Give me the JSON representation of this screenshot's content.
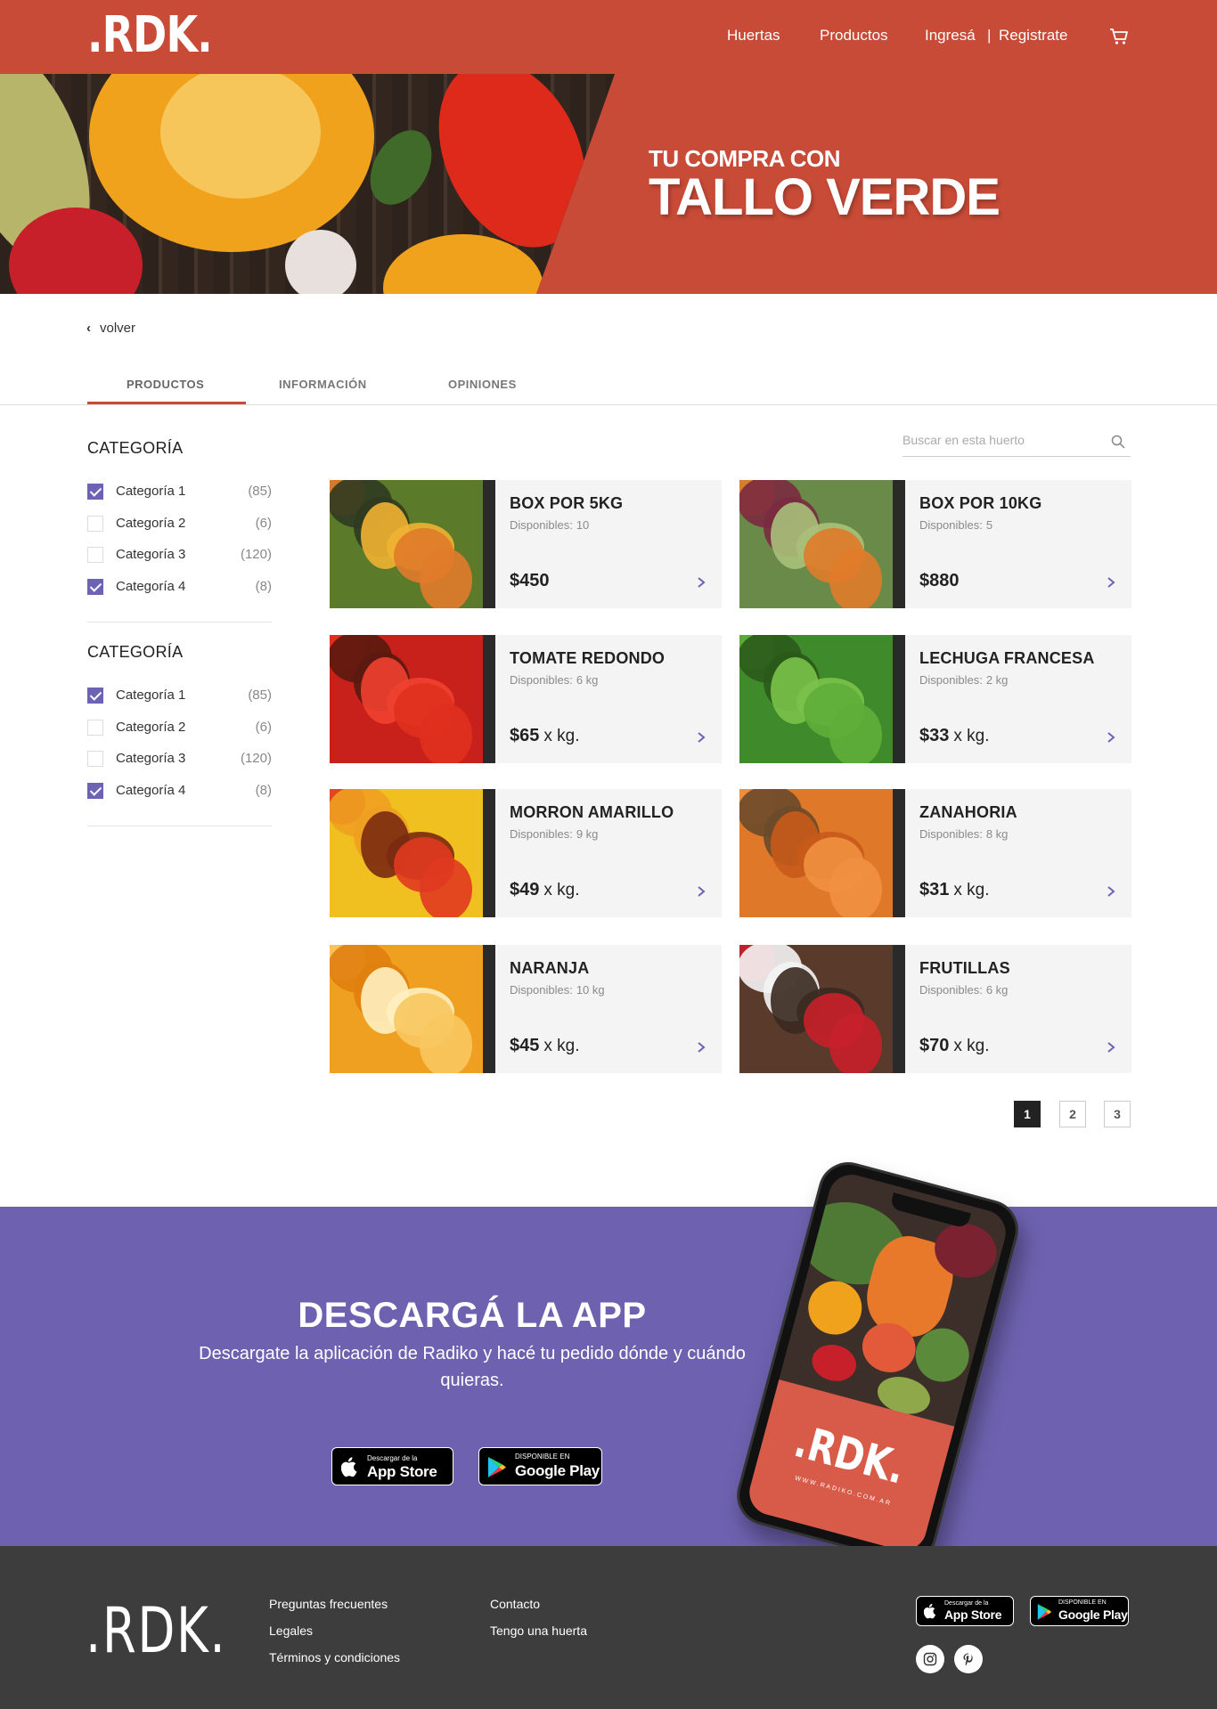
{
  "header": {
    "logo": ".RDK.",
    "nav": {
      "huertas": "Huertas",
      "productos": "Productos",
      "ingresa": "Ingresá",
      "separator": "|",
      "registrate": "Registrate"
    },
    "cart_icon": "cart-icon"
  },
  "hero": {
    "subtitle": "TU COMPRA CON",
    "title": "TALLO VERDE"
  },
  "back": {
    "label": "volver"
  },
  "tabs": [
    {
      "label": "PRODUCTOS",
      "active": true
    },
    {
      "label": "INFORMACIÓN",
      "active": false
    },
    {
      "label": "OPINIONES",
      "active": false
    }
  ],
  "filters": [
    {
      "title": "CATEGORÍA",
      "items": [
        {
          "label": "Categoría 1",
          "count": "(85)",
          "checked": true
        },
        {
          "label": "Categoría 2",
          "count": "(6)",
          "checked": false
        },
        {
          "label": "Categoría 3",
          "count": "(120)",
          "checked": false
        },
        {
          "label": "Categoría 4",
          "count": "(8)",
          "checked": true
        }
      ]
    },
    {
      "title": "CATEGORÍA",
      "items": [
        {
          "label": "Categoría 1",
          "count": "(85)",
          "checked": true
        },
        {
          "label": "Categoría 2",
          "count": "(6)",
          "checked": false
        },
        {
          "label": "Categoría 3",
          "count": "(120)",
          "checked": false
        },
        {
          "label": "Categoría 4",
          "count": "(8)",
          "checked": true
        }
      ]
    }
  ],
  "search": {
    "placeholder": "Buscar en esta huerto"
  },
  "products": [
    {
      "name": "BOX POR 5KG",
      "avail_label": "Disponibles:",
      "avail_value": "10",
      "price": "$450",
      "unit": ""
    },
    {
      "name": "BOX POR 10KG",
      "avail_label": "Disponibles:",
      "avail_value": "5",
      "price": "$880",
      "unit": ""
    },
    {
      "name": "TOMATE REDONDO",
      "avail_label": "Disponibles:",
      "avail_value": "6 kg",
      "price": "$65",
      "unit": "x kg."
    },
    {
      "name": "LECHUGA FRANCESA",
      "avail_label": "Disponibles:",
      "avail_value": "2 kg",
      "price": "$33",
      "unit": "x kg."
    },
    {
      "name": "MORRON AMARILLO",
      "avail_label": "Disponibles:",
      "avail_value": "9 kg",
      "price": "$49",
      "unit": "x kg."
    },
    {
      "name": "ZANAHORIA",
      "avail_label": "Disponibles:",
      "avail_value": "8 kg",
      "price": "$31",
      "unit": "x kg."
    },
    {
      "name": "NARANJA",
      "avail_label": "Disponibles:",
      "avail_value": "10 kg",
      "price": "$45",
      "unit": "x kg."
    },
    {
      "name": "FRUTILLAS",
      "avail_label": "Disponibles:",
      "avail_value": "6 kg",
      "price": "$70",
      "unit": "x kg."
    }
  ],
  "pagination": {
    "pages": [
      "1",
      "2",
      "3"
    ],
    "current": "1"
  },
  "app": {
    "title": "DESCARGÁ LA APP",
    "description": "Descargate la aplicación  de Radiko y hacé tu pedido dónde y cuándo quieras.",
    "appstore": {
      "small": "Descargar de la",
      "big": "App Store"
    },
    "googleplay": {
      "small": "DISPONIBLE EN",
      "big": "Google Play"
    },
    "phone_logo": ".RDK.",
    "phone_url": "WWW.RADIKO.COM.AR"
  },
  "footer": {
    "logo": ".RDK.",
    "links_col1": [
      "Preguntas frecuentes",
      "Legales",
      "Términos y condiciones"
    ],
    "links_col2": [
      "Contacto",
      "Tengo una huerta"
    ],
    "appstore": {
      "small": "Descargar de la",
      "big": "App Store"
    },
    "googleplay": {
      "small": "DISPONIBLE EN",
      "big": "Google Play"
    },
    "social": [
      "instagram-icon",
      "pinterest-icon"
    ]
  },
  "colors": {
    "brand_red": "#c84b37",
    "purple": "#6e62b0",
    "footer": "#3d3d3d",
    "check": "#6c63b5"
  }
}
